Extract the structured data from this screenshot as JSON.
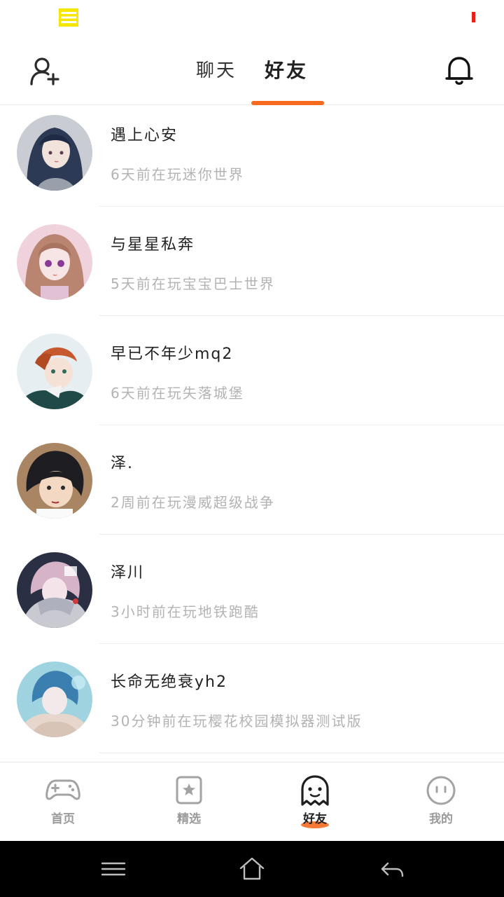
{
  "status_bar": {
    "menu_icon": "menu-icon",
    "battery_color": "#e8201a"
  },
  "top_nav": {
    "tabs": [
      {
        "label": "聊天",
        "active": false
      },
      {
        "label": "好友",
        "active": true
      }
    ],
    "accent_color": "#f56a1f",
    "left_icon": "add-friend-icon",
    "right_icon": "bell-icon"
  },
  "friends": [
    {
      "name": "遇上心安",
      "status": "6天前在玩迷你世界"
    },
    {
      "name": "与星星私奔",
      "status": "5天前在玩宝宝巴士世界"
    },
    {
      "name": "早已不年少mq2",
      "status": "6天前在玩失落城堡"
    },
    {
      "name": "泽.",
      "status": "2周前在玩漫威超级战争"
    },
    {
      "name": "泽川",
      "status": "3小时前在玩地铁跑酷"
    },
    {
      "name": "长命无绝衰yh2",
      "status": "30分钟前在玩樱花校园模拟器测试版"
    }
  ],
  "bottom_tabs": [
    {
      "label": "首页",
      "icon": "gamepad-icon",
      "active": false
    },
    {
      "label": "精选",
      "icon": "star-badge-icon",
      "active": false
    },
    {
      "label": "好友",
      "icon": "ghost-icon",
      "active": true
    },
    {
      "label": "我的",
      "icon": "face-icon",
      "active": false
    }
  ],
  "system_nav": [
    "menu-icon",
    "home-icon",
    "back-icon"
  ]
}
